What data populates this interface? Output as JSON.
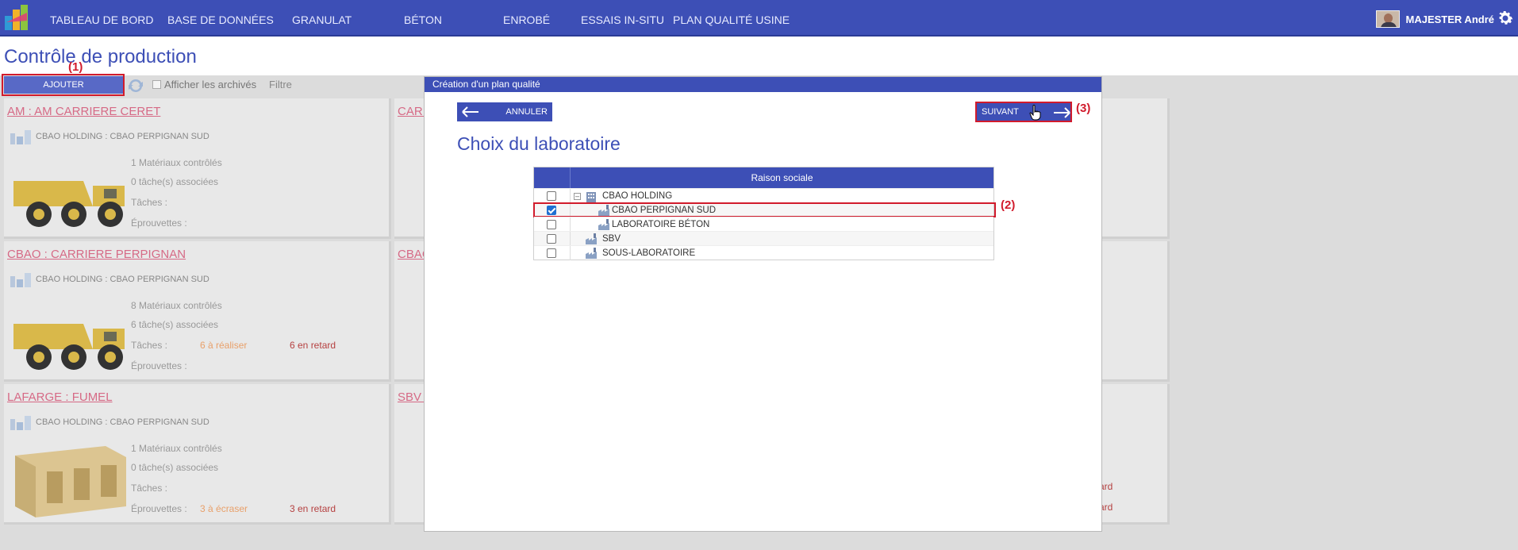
{
  "nav": {
    "items": [
      "TABLEAU DE BORD",
      "BASE DE DONNÉES",
      "GRANULAT",
      "BÉTON",
      "ENROBÉ",
      "ESSAIS IN-SITU",
      "PLAN QUALITÉ USINE"
    ],
    "user_name": "MAJESTER André"
  },
  "page": {
    "title": "Contrôle de production"
  },
  "toolbar": {
    "add_label": "AJOUTER",
    "archive_label": "Afficher les archivés",
    "filter_label": "Filtre"
  },
  "cards": [
    {
      "title": "AM : AM CARRIERE CERET",
      "sub": "CBAO HOLDING : CBAO PERPIGNAN SUD",
      "materials": "1 Matériaux contrôlés",
      "tasks_assoc": "0 tâche(s) associées",
      "tasks": "Tâches :",
      "tasks_todo": "",
      "tasks_late": "",
      "samples": "Éprouvettes :",
      "samples_todo": "",
      "samples_late": ""
    },
    {
      "title": "CBAO : CARRIERE PERPIGNAN",
      "sub": "CBAO HOLDING : CBAO PERPIGNAN SUD",
      "materials": "8 Matériaux contrôlés",
      "tasks_assoc": "6 tâche(s) associées",
      "tasks": "Tâches :",
      "tasks_todo": "6 à réaliser",
      "tasks_late": "6 en retard",
      "samples": "Éprouvettes :",
      "samples_todo": "",
      "samples_late": ""
    },
    {
      "title": "LAFARGE : FUMEL",
      "sub": "CBAO HOLDING : CBAO PERPIGNAN SUD",
      "materials": "1 Matériaux contrôlés",
      "tasks_assoc": "0 tâche(s) associées",
      "tasks": "Tâches :",
      "tasks_todo": "",
      "tasks_late": "",
      "samples": "Éprouvettes :",
      "samples_todo": "3 à écraser",
      "samples_late": "3 en retard"
    }
  ],
  "cards_right": {
    "titles": [
      "CARI",
      "CBAC",
      "SBV :"
    ],
    "fragments": [
      "ard",
      "ard"
    ]
  },
  "modal": {
    "header": "Création d'un plan qualité",
    "cancel_label": "ANNULER",
    "next_label": "SUIVANT",
    "title": "Choix du laboratoire",
    "table_header": "Raison sociale",
    "rows": [
      {
        "label": "CBAO HOLDING",
        "checked": false
      },
      {
        "label": "CBAO PERPIGNAN SUD",
        "checked": true
      },
      {
        "label": "LABORATOIRE BÉTON",
        "checked": false
      },
      {
        "label": "SBV",
        "checked": false
      },
      {
        "label": "SOUS-LABORATOIRE",
        "checked": false
      }
    ]
  },
  "annotations": [
    "(1)",
    "(2)",
    "(3)"
  ],
  "colors": {
    "primary": "#3d4fb6",
    "annotation": "#d11b2c",
    "link_pink": "#d66a86",
    "todo_orange": "#e8a06a",
    "late_red": "#b54040"
  }
}
